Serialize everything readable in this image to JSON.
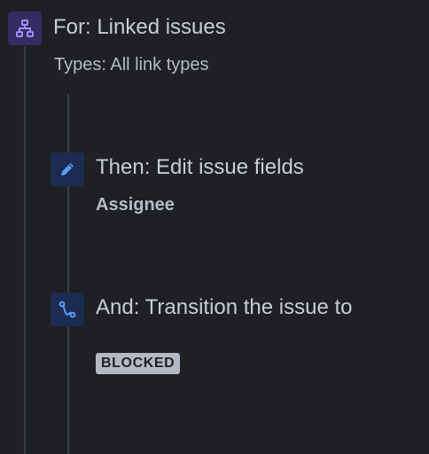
{
  "branch": {
    "title": "For: Linked issues",
    "subtitle": "Types: All link types",
    "icon": "branch-icon"
  },
  "actions": [
    {
      "title": "Then: Edit issue fields",
      "detail": "Assignee",
      "icon": "pencil-icon"
    },
    {
      "title": "And: Transition the issue to",
      "status": "BLOCKED",
      "icon": "transition-icon"
    }
  ],
  "colors": {
    "background": "#1e2025",
    "branch_icon_bg": "#352c63",
    "branch_icon_fg": "#9f8fef",
    "action_icon_bg": "#1c2b52",
    "action_icon_fg": "#579dff",
    "lozenge_bg": "#b3b9c4"
  }
}
